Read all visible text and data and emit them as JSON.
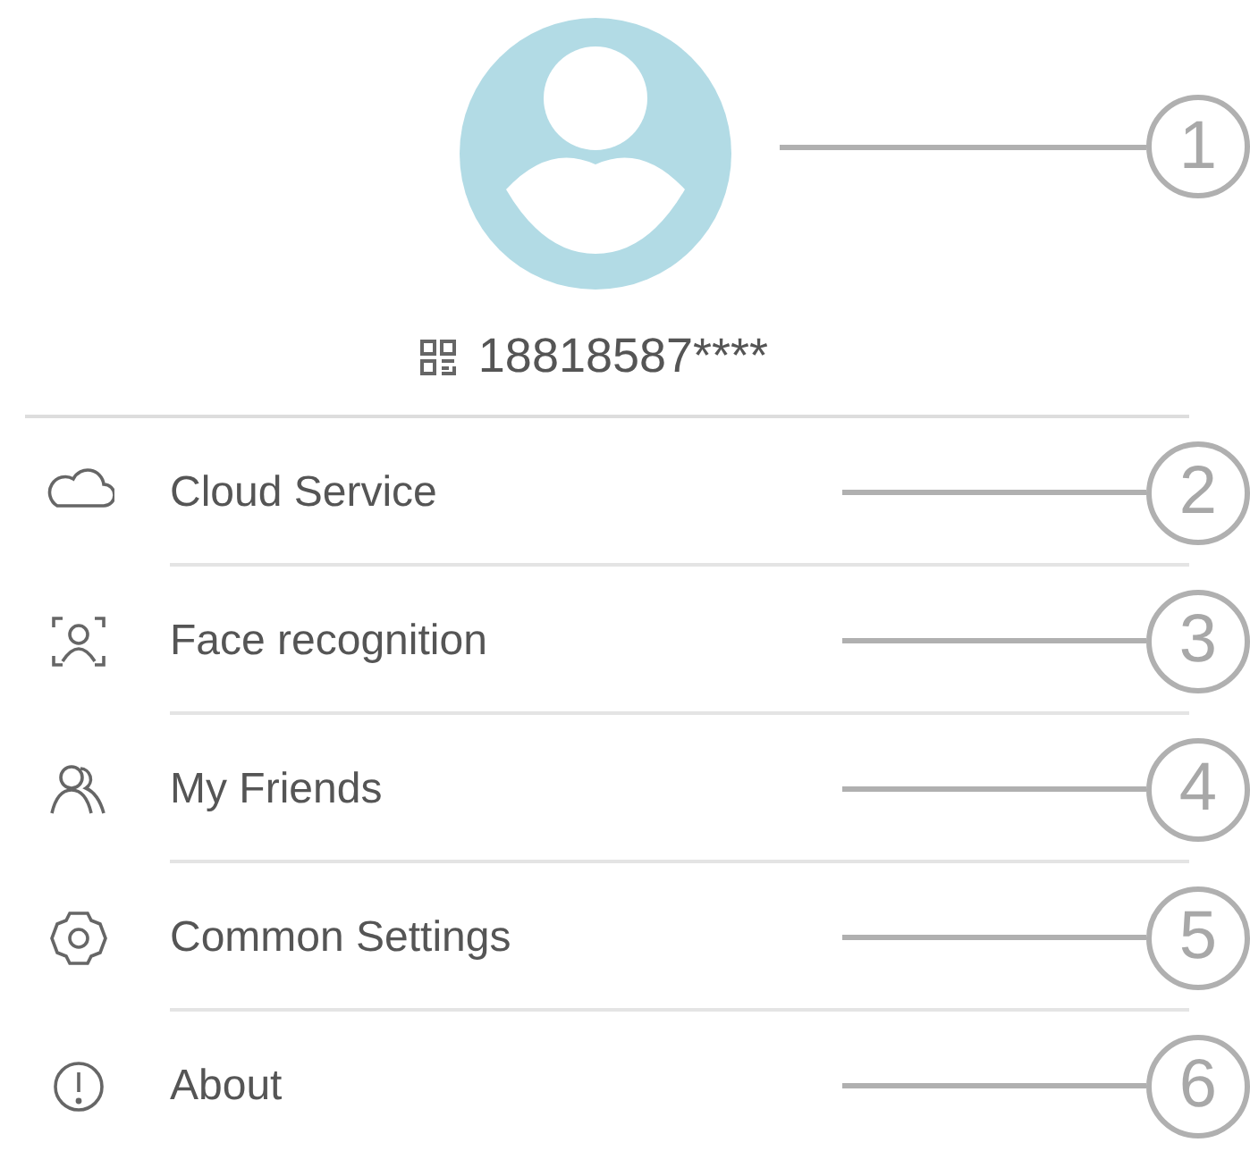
{
  "profile": {
    "account": "18818587****",
    "callout": "1"
  },
  "menu": [
    {
      "kind": "cloud",
      "label": "Cloud Service",
      "callout": "2"
    },
    {
      "kind": "face",
      "label": "Face recognition",
      "callout": "3"
    },
    {
      "kind": "friends",
      "label": "My Friends",
      "callout": "4"
    },
    {
      "kind": "settings",
      "label": "Common Settings",
      "callout": "5"
    },
    {
      "kind": "info",
      "label": "About",
      "callout": "6"
    }
  ]
}
